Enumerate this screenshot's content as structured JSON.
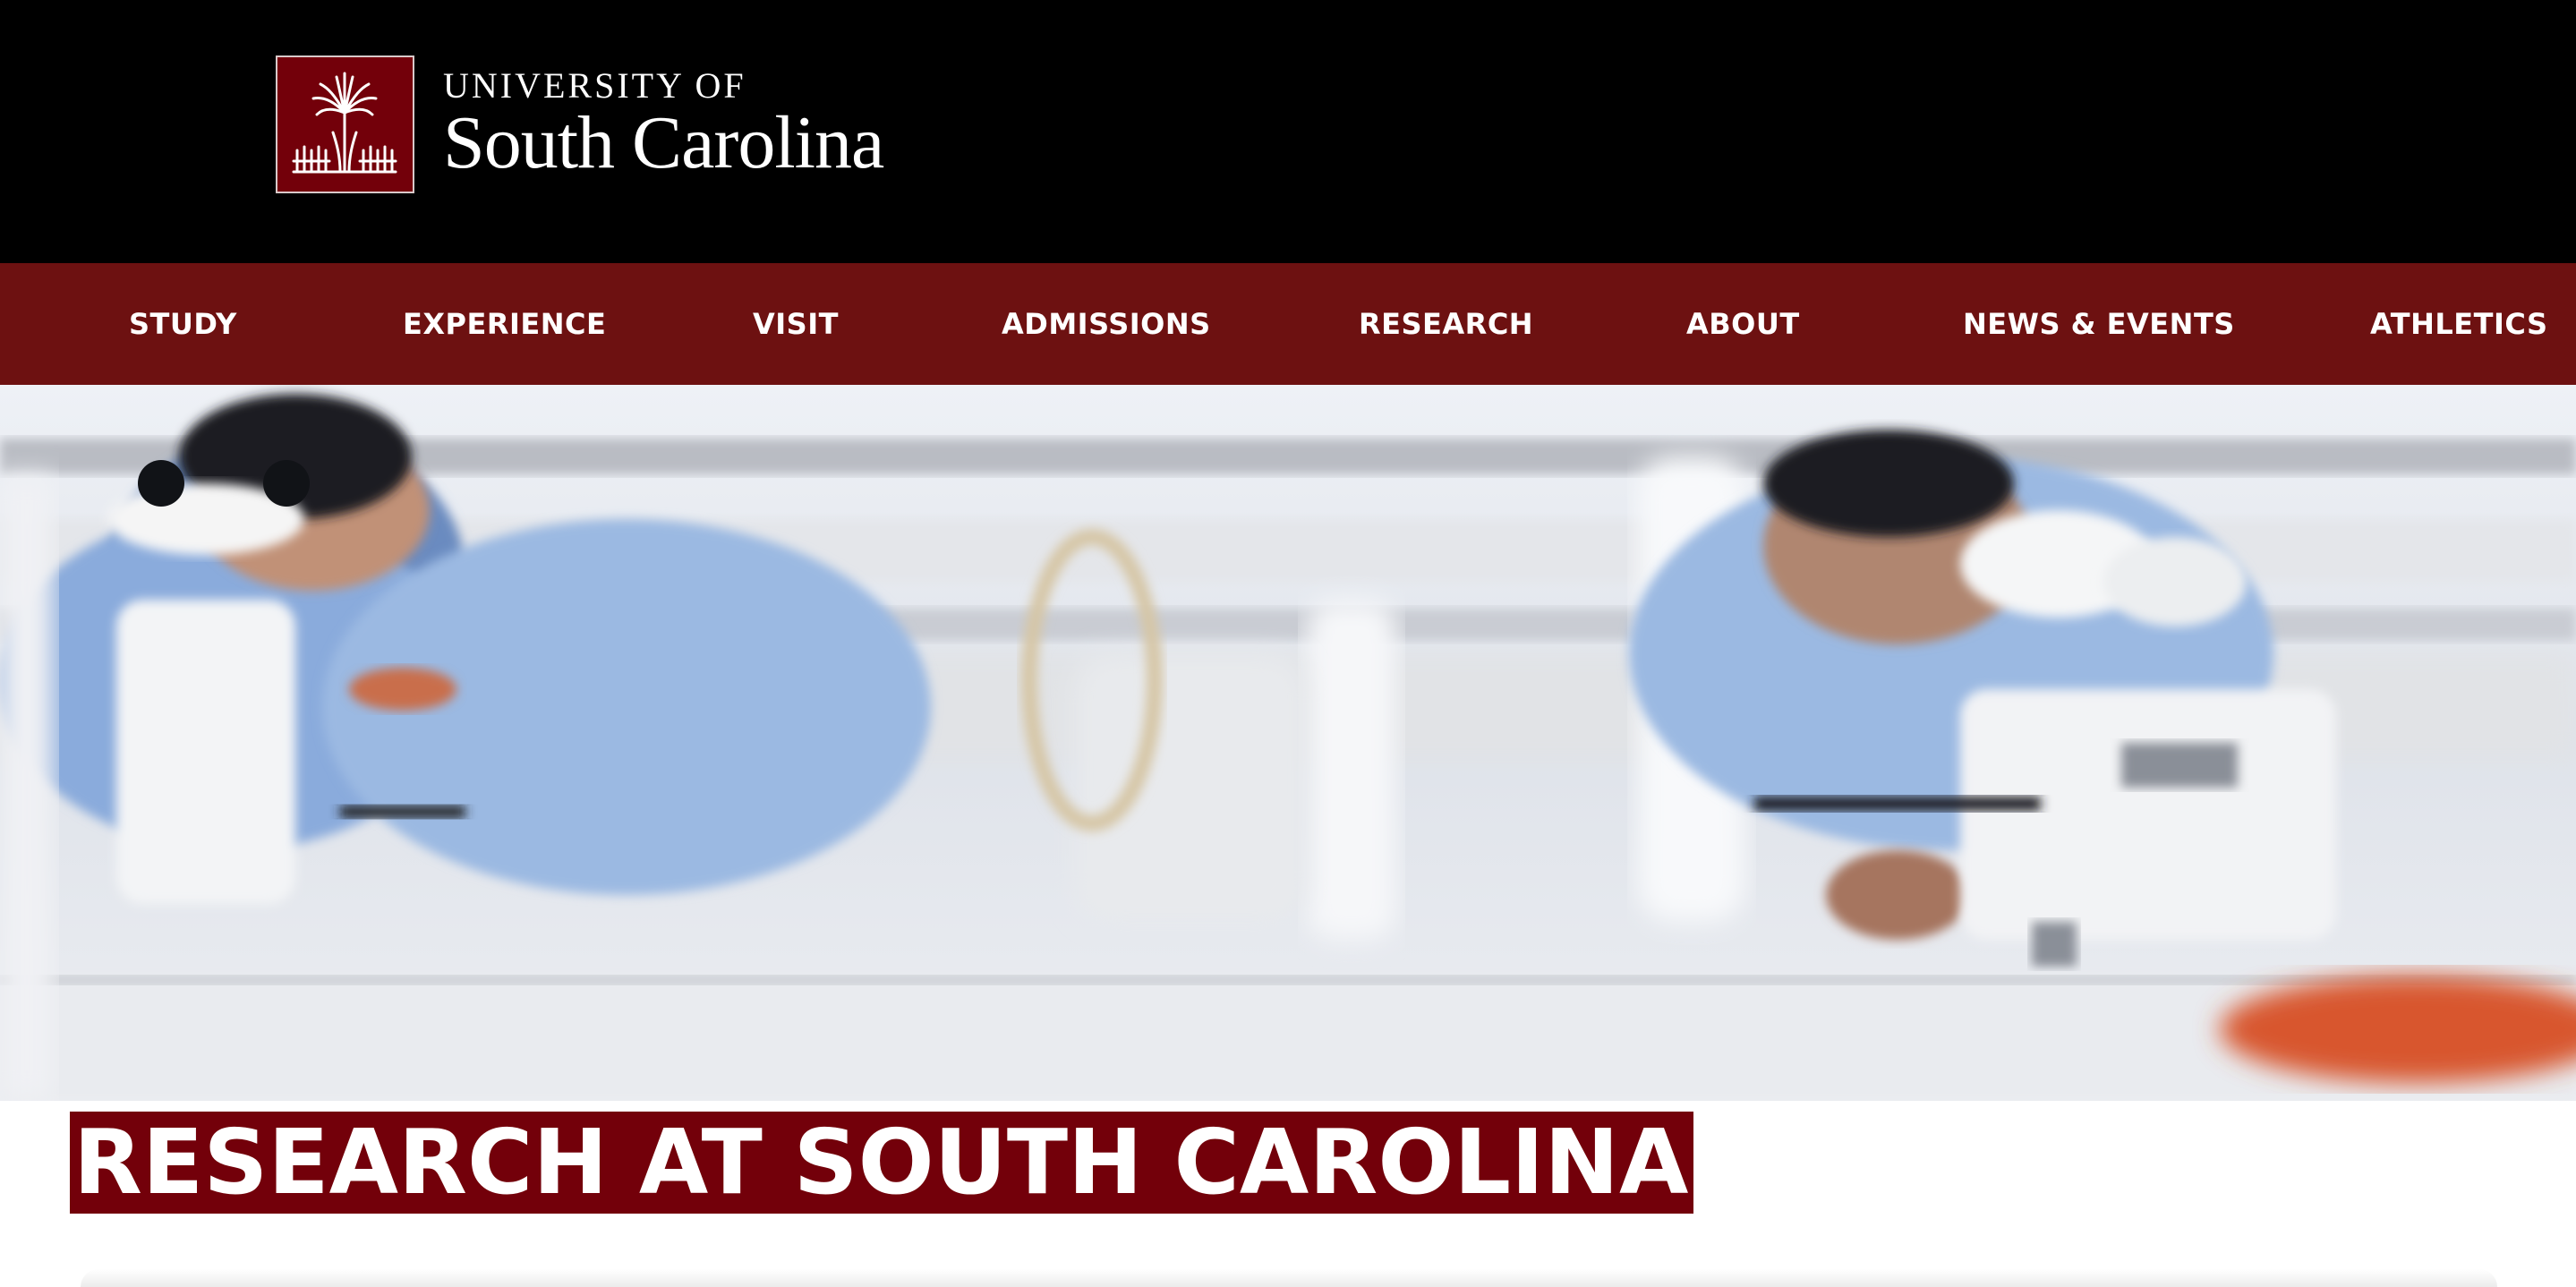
{
  "header": {
    "logo": {
      "line1": "UNIVERSITY OF",
      "line2": "South Carolina",
      "icon": "palmetto-tree-icon"
    }
  },
  "nav": {
    "items": [
      {
        "label": "STUDY"
      },
      {
        "label": "EXPERIENCE"
      },
      {
        "label": "VISIT"
      },
      {
        "label": "ADMISSIONS"
      },
      {
        "label": "RESEARCH"
      },
      {
        "label": "ABOUT"
      },
      {
        "label": "NEWS & EVENTS"
      },
      {
        "label": "ATHLETICS"
      }
    ]
  },
  "hero": {
    "image": "researchers-with-microscopes-photo"
  },
  "page": {
    "title": "RESEARCH AT SOUTH CAROLINA"
  },
  "colors": {
    "header_bg": "#000000",
    "nav_bg": "#6d1111",
    "brand_garnet": "#73000a",
    "text_light": "#ffffff"
  }
}
